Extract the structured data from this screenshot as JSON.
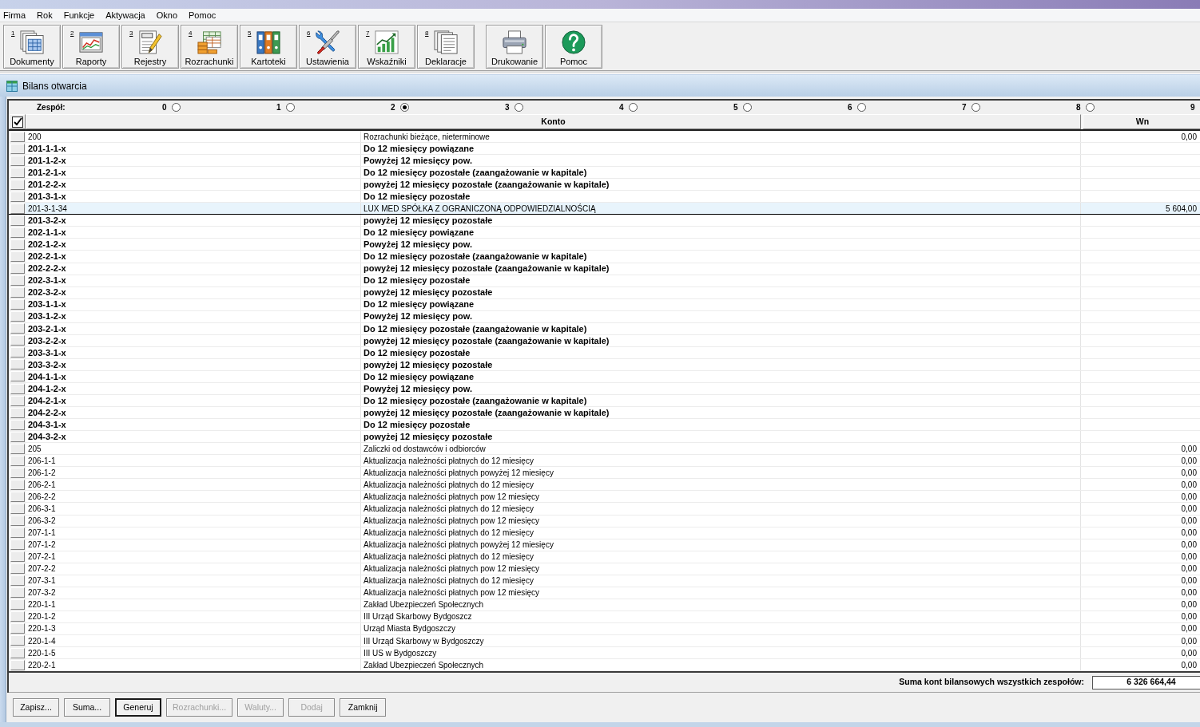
{
  "menu": [
    "Firma",
    "Rok",
    "Funkcje",
    "Aktywacja",
    "Okno",
    "Pomoc"
  ],
  "toolbar": [
    {
      "items": [
        {
          "key": "1",
          "label": "Dokumenty"
        },
        {
          "key": "2",
          "label": "Raporty"
        },
        {
          "key": "3",
          "label": "Rejestry"
        },
        {
          "key": "4",
          "label": "Rozrachunki"
        },
        {
          "key": "5",
          "label": "Kartoteki"
        },
        {
          "key": "6",
          "label": "Ustawienia"
        },
        {
          "key": "7",
          "label": "Wskaźniki"
        },
        {
          "key": "8",
          "label": "Deklaracje"
        }
      ]
    },
    {
      "items": [
        {
          "label": "Drukowanie"
        },
        {
          "label": "Pomoc"
        }
      ]
    }
  ],
  "window": {
    "title": "Bilans otwarcia"
  },
  "team_selector": {
    "label": "Zespół:",
    "options": [
      {
        "label": "0",
        "selected": false
      },
      {
        "label": "1",
        "selected": false
      },
      {
        "label": "2",
        "selected": true
      },
      {
        "label": "3",
        "selected": false
      },
      {
        "label": "4",
        "selected": false
      },
      {
        "label": "5",
        "selected": false
      },
      {
        "label": "6",
        "selected": false
      },
      {
        "label": "7",
        "selected": false
      },
      {
        "label": "8",
        "selected": false
      },
      {
        "label": "9"
      }
    ]
  },
  "table": {
    "columns": [
      "Konto",
      "Wn"
    ],
    "rows": [
      {
        "account": "200",
        "name": "Rozrachunki bieżące, nieterminowe",
        "wn": "0,00",
        "kind": "account",
        "selected": false
      },
      {
        "account": "201-1-1-x",
        "name": "Do 12 miesięcy powiązane",
        "kind": "group",
        "selected": false
      },
      {
        "account": "201-1-2-x",
        "name": "Powyżej 12 miesięcy pow.",
        "kind": "group",
        "selected": false
      },
      {
        "account": "201-2-1-x",
        "name": "Do 12 miesięcy pozostałe (zaangażowanie w kapitale)",
        "kind": "group",
        "selected": false
      },
      {
        "account": "201-2-2-x",
        "name": "powyżej 12 miesięcy pozostałe (zaangażowanie w kapitale)",
        "kind": "group",
        "selected": false
      },
      {
        "account": "201-3-1-x",
        "name": "Do 12 miesięcy pozostałe",
        "kind": "group",
        "selected": false
      },
      {
        "account": "201-3-1-34",
        "name": "LUX MED SPÓŁKA Z OGRANICZONĄ ODPOWIEDZIALNOŚCIĄ",
        "wn": "5 604,00",
        "kind": "account",
        "selected": true
      },
      {
        "account": "201-3-2-x",
        "name": "powyżej 12 miesięcy pozostałe",
        "kind": "group",
        "selected": false
      },
      {
        "account": "202-1-1-x",
        "name": "Do 12 miesięcy powiązane",
        "kind": "group",
        "selected": false
      },
      {
        "account": "202-1-2-x",
        "name": "Powyżej 12 miesięcy pow.",
        "kind": "group",
        "selected": false
      },
      {
        "account": "202-2-1-x",
        "name": "Do 12 miesięcy pozostałe (zaangażowanie w kapitale)",
        "kind": "group",
        "selected": false
      },
      {
        "account": "202-2-2-x",
        "name": "powyżej 12 miesięcy pozostałe (zaangażowanie w kapitale)",
        "kind": "group",
        "selected": false
      },
      {
        "account": "202-3-1-x",
        "name": "Do 12 miesięcy pozostałe",
        "kind": "group",
        "selected": false
      },
      {
        "account": "202-3-2-x",
        "name": "powyżej 12 miesięcy pozostałe",
        "kind": "group",
        "selected": false
      },
      {
        "account": "203-1-1-x",
        "name": "Do 12 miesięcy powiązane",
        "kind": "group",
        "selected": false
      },
      {
        "account": "203-1-2-x",
        "name": "Powyżej 12 miesięcy pow.",
        "kind": "group",
        "selected": false
      },
      {
        "account": "203-2-1-x",
        "name": "Do 12 miesięcy pozostałe (zaangażowanie w kapitale)",
        "kind": "group",
        "selected": false
      },
      {
        "account": "203-2-2-x",
        "name": "powyżej 12 miesięcy pozostałe (zaangażowanie w kapitale)",
        "kind": "group",
        "selected": false
      },
      {
        "account": "203-3-1-x",
        "name": "Do 12 miesięcy pozostałe",
        "kind": "group",
        "selected": false
      },
      {
        "account": "203-3-2-x",
        "name": "powyżej 12 miesięcy pozostałe",
        "kind": "group",
        "selected": false
      },
      {
        "account": "204-1-1-x",
        "name": "Do 12 miesięcy powiązane",
        "kind": "group",
        "selected": false
      },
      {
        "account": "204-1-2-x",
        "name": "Powyżej 12 miesięcy pow.",
        "kind": "group",
        "selected": false
      },
      {
        "account": "204-2-1-x",
        "name": "Do 12 miesięcy pozostałe (zaangażowanie w kapitale)",
        "kind": "group",
        "selected": false
      },
      {
        "account": "204-2-2-x",
        "name": "powyżej 12 miesięcy pozostałe (zaangażowanie w kapitale)",
        "kind": "group",
        "selected": false
      },
      {
        "account": "204-3-1-x",
        "name": "Do 12 miesięcy pozostałe",
        "kind": "group",
        "selected": false
      },
      {
        "account": "204-3-2-x",
        "name": "powyżej 12 miesięcy pozostałe",
        "kind": "group",
        "selected": false
      },
      {
        "account": "205",
        "name": "Zaliczki od dostawców i odbiorców",
        "wn": "0,00",
        "kind": "account",
        "selected": false
      },
      {
        "account": "206-1-1",
        "name": "Aktualizacja należności płatnych do 12 miesięcy",
        "wn": "0,00",
        "kind": "account",
        "selected": false
      },
      {
        "account": "206-1-2",
        "name": "Aktualizacja należności płatnych powyżej 12 miesięcy",
        "wn": "0,00",
        "kind": "account",
        "selected": false
      },
      {
        "account": "206-2-1",
        "name": "Aktualizacja należności płatnych do 12 miesięcy",
        "wn": "0,00",
        "kind": "account",
        "selected": false
      },
      {
        "account": "206-2-2",
        "name": "Aktualizacja należności płatnych pow 12 miesięcy",
        "wn": "0,00",
        "kind": "account",
        "selected": false
      },
      {
        "account": "206-3-1",
        "name": "Aktualizacja należności płatnych do 12 miesięcy",
        "wn": "0,00",
        "kind": "account",
        "selected": false
      },
      {
        "account": "206-3-2",
        "name": "Aktualizacja należności płatnych pow 12 miesięcy",
        "wn": "0,00",
        "kind": "account",
        "selected": false
      },
      {
        "account": "207-1-1",
        "name": "Aktualizacja należności płatnych do 12 miesięcy",
        "wn": "0,00",
        "kind": "account",
        "selected": false
      },
      {
        "account": "207-1-2",
        "name": "Aktualizacja należności płatnych powyżej 12 miesięcy",
        "wn": "0,00",
        "kind": "account",
        "selected": false
      },
      {
        "account": "207-2-1",
        "name": "Aktualizacja należności płatnych do 12 miesięcy",
        "wn": "0,00",
        "kind": "account",
        "selected": false
      },
      {
        "account": "207-2-2",
        "name": "Aktualizacja należności płatnych pow 12 miesięcy",
        "wn": "0,00",
        "kind": "account",
        "selected": false
      },
      {
        "account": "207-3-1",
        "name": "Aktualizacja należności płatnych do 12 miesięcy",
        "wn": "0,00",
        "kind": "account",
        "selected": false
      },
      {
        "account": "207-3-2",
        "name": "Aktualizacja należności płatnych pow 12 miesięcy",
        "wn": "0,00",
        "kind": "account",
        "selected": false
      },
      {
        "account": "220-1-1",
        "name": "Zakład Ubezpieczeń Społecznych",
        "wn": "0,00",
        "kind": "account",
        "selected": false
      },
      {
        "account": "220-1-2",
        "name": "III Urząd Skarbowy Bydgoszcz",
        "wn": "0,00",
        "kind": "account",
        "selected": false
      },
      {
        "account": "220-1-3",
        "name": "Urząd Miasta Bydgoszczy",
        "wn": "0,00",
        "kind": "account",
        "selected": false
      },
      {
        "account": "220-1-4",
        "name": "III Urząd Skarbowy w Bydgoszczy",
        "wn": "0,00",
        "kind": "account",
        "selected": false
      },
      {
        "account": "220-1-5",
        "name": "III US w Bydgoszczy",
        "wn": "0,00",
        "kind": "account",
        "selected": false
      },
      {
        "account": "220-2-1",
        "name": "Zakład Ubezpieczeń Społecznych",
        "wn": "0,00",
        "kind": "account",
        "selected": false
      }
    ]
  },
  "summary": {
    "label": "Suma kont bilansowych wszystkich zespołów:",
    "value": "6 326 664,44"
  },
  "buttons": [
    {
      "label": "Zapisz...",
      "disabled": false,
      "default": false
    },
    {
      "label": "Suma...",
      "disabled": false,
      "default": false
    },
    {
      "label": "Generuj",
      "disabled": false,
      "default": true
    },
    {
      "label": "Rozrachunki...",
      "disabled": true,
      "default": false
    },
    {
      "label": "Waluty...",
      "disabled": true,
      "default": false
    },
    {
      "label": "Dodaj",
      "disabled": true,
      "default": false
    },
    {
      "label": "Zamknij",
      "disabled": false,
      "default": false
    }
  ]
}
